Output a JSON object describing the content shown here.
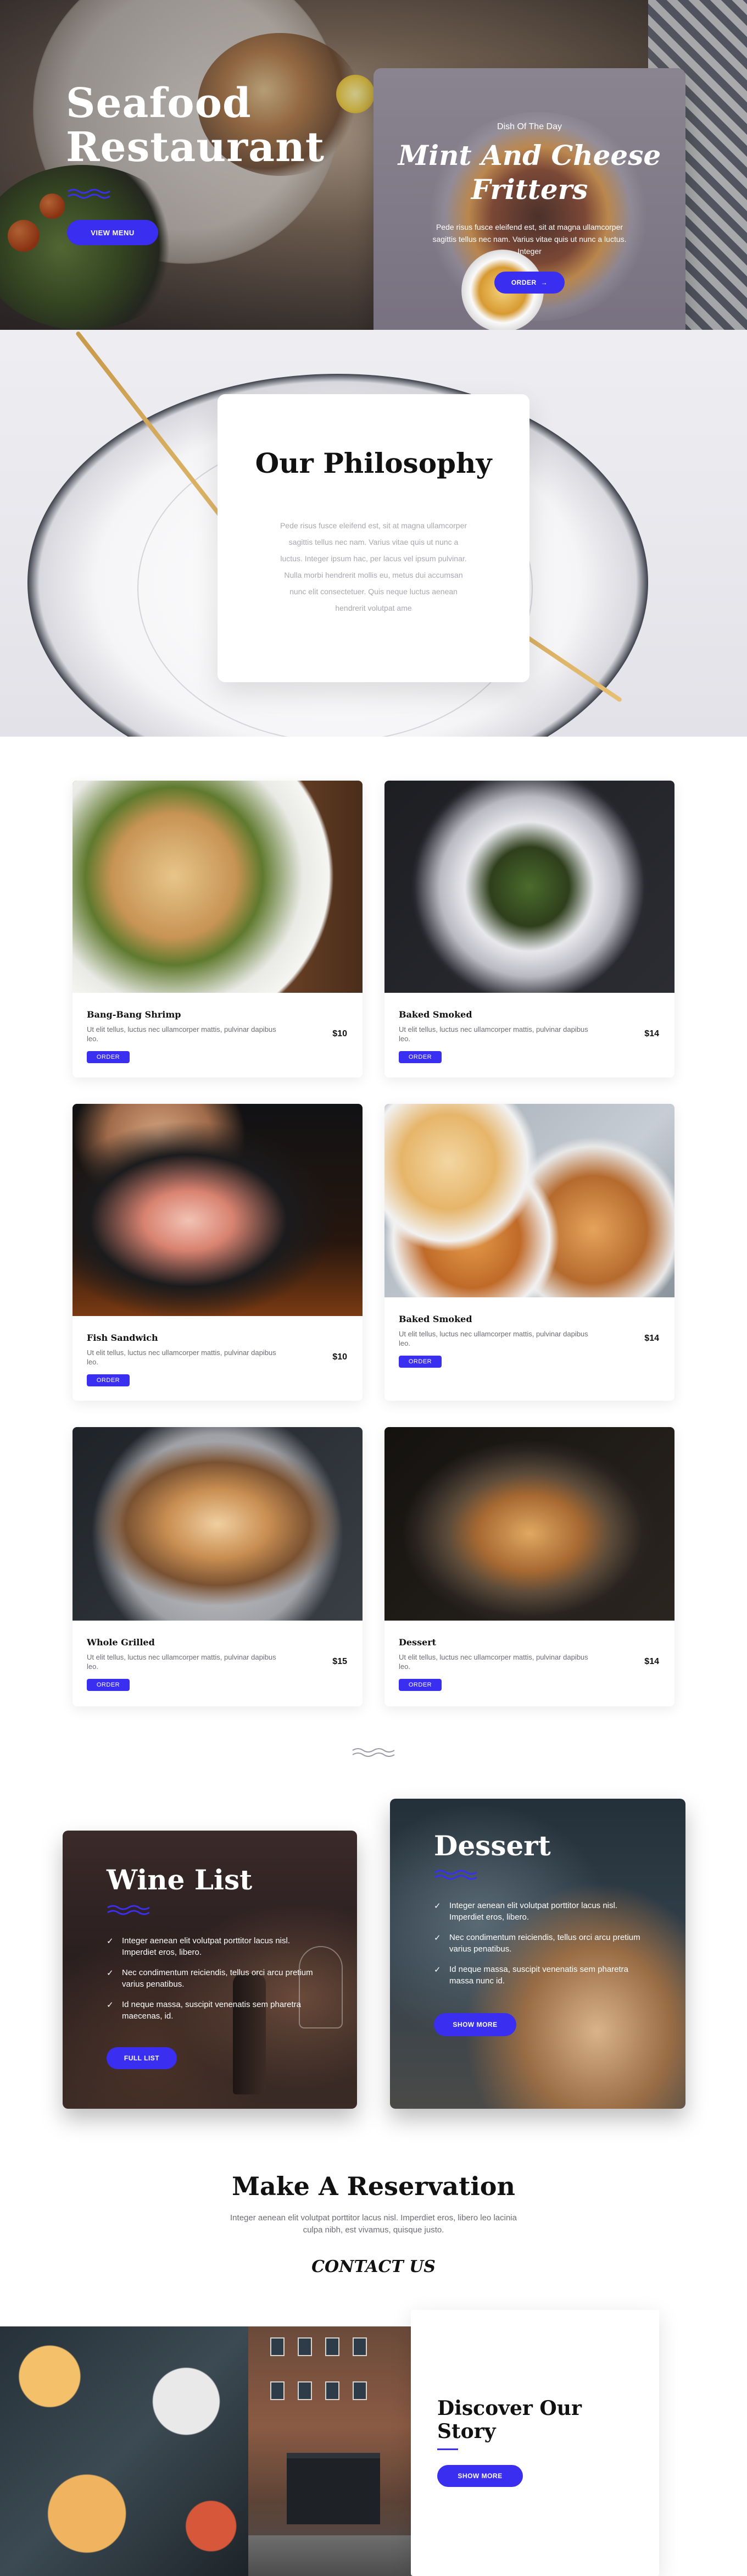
{
  "colors": {
    "accent": "#3a2ff0",
    "text_dark": "#111111",
    "text_muted": "#6c6c74"
  },
  "hero": {
    "title": "Seafood Restaurant",
    "button_label": "VIEW MENU"
  },
  "dish_of_day": {
    "label": "Dish Of The Day",
    "name": "Mint And Cheese Fritters",
    "description": "Pede risus fusce eleifend est, sit at magna ullamcorper sagittis tellus nec nam. Varius vitae quis ut nunc a luctus. Integer",
    "button_label": "ORDER",
    "button_icon": "arrow-right-icon"
  },
  "philosophy": {
    "title": "Our Philosophy",
    "text": "Pede risus fusce eleifend est, sit at magna ullamcorper sagittis tellus nec nam. Varius vitae quis ut nunc a luctus. Integer ipsum hac, per lacus vel ipsum pulvinar. Nulla morbi hendrerit mollis eu, metus dui accumsan nunc elit consectetuer. Quis neque luctus aenean hendrerit volutpat ame"
  },
  "menu": {
    "items": [
      {
        "name": "Bang-Bang Shrimp",
        "desc": "Ut elit tellus, luctus nec ullamcorper mattis, pulvinar dapibus leo.",
        "price": "$10",
        "button": "ORDER"
      },
      {
        "name": "Baked Smoked",
        "desc": "Ut elit tellus, luctus nec ullamcorper mattis, pulvinar dapibus leo.",
        "price": "$14",
        "button": "ORDER"
      },
      {
        "name": "Fish Sandwich",
        "desc": "Ut elit tellus, luctus nec ullamcorper mattis, pulvinar dapibus leo.",
        "price": "$10",
        "button": "ORDER"
      },
      {
        "name": "Baked Smoked",
        "desc": "Ut elit tellus, luctus nec ullamcorper mattis, pulvinar dapibus leo.",
        "price": "$14",
        "button": "ORDER"
      },
      {
        "name": "Whole Grilled",
        "desc": "Ut elit tellus, luctus nec ullamcorper mattis, pulvinar dapibus leo.",
        "price": "$15",
        "button": "ORDER"
      },
      {
        "name": "Dessert",
        "desc": "Ut elit tellus, luctus nec ullamcorper mattis, pulvinar dapibus leo.",
        "price": "$14",
        "button": "ORDER"
      }
    ]
  },
  "wine": {
    "title": "Wine List",
    "items": [
      "Integer aenean elit volutpat porttitor lacus nisl. Imperdiet eros, libero.",
      "Nec condimentum reiciendis, tellus orci arcu pretium varius penatibus.",
      "Id neque massa, suscipit venenatis sem pharetra maecenas, id."
    ],
    "button_label": "FULL LIST"
  },
  "dessert": {
    "title": "Dessert",
    "items": [
      "Integer aenean elit volutpat porttitor lacus nisl. Imperdiet eros, libero.",
      "Nec condimentum reiciendis, tellus orci arcu pretium varius penatibus.",
      "Id neque massa, suscipit venenatis sem pharetra massa nunc id."
    ],
    "button_label": "SHOW MORE"
  },
  "reservation": {
    "title": "Make A Reservation",
    "text": "Integer aenean elit volutpat porttitor lacus nisl. Imperdiet eros, libero leo lacinia culpa nibh, est vivamus, quisque justo.",
    "contact_label": "CONTACT US"
  },
  "story": {
    "title": "Discover Our Story",
    "button_label": "SHOW MORE"
  }
}
